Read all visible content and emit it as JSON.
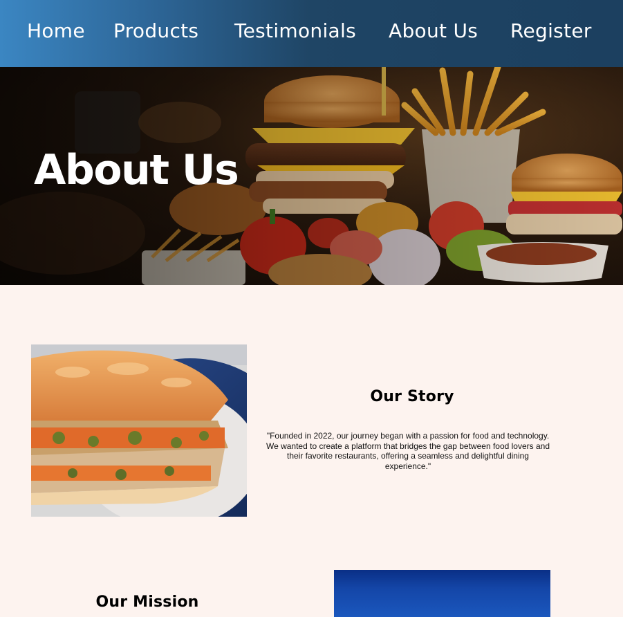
{
  "nav": {
    "items": [
      {
        "label": "Home"
      },
      {
        "label": "Products"
      },
      {
        "label": "Testimonials"
      },
      {
        "label": "About Us"
      },
      {
        "label": "Register"
      }
    ]
  },
  "hero": {
    "title": "About Us"
  },
  "story": {
    "title": "Our Story",
    "text": "\"Founded in 2022, our journey began with a passion for food and technology. We wanted to create a platform that bridges the gap between food lovers and their favorite restaurants, offering a seamless and delightful dining experience.\""
  },
  "mission": {
    "title": "Our Mission"
  },
  "colors": {
    "nav_start": "#3b86c2",
    "nav_end": "#1c4060",
    "page_background": "#fdf3ef"
  }
}
